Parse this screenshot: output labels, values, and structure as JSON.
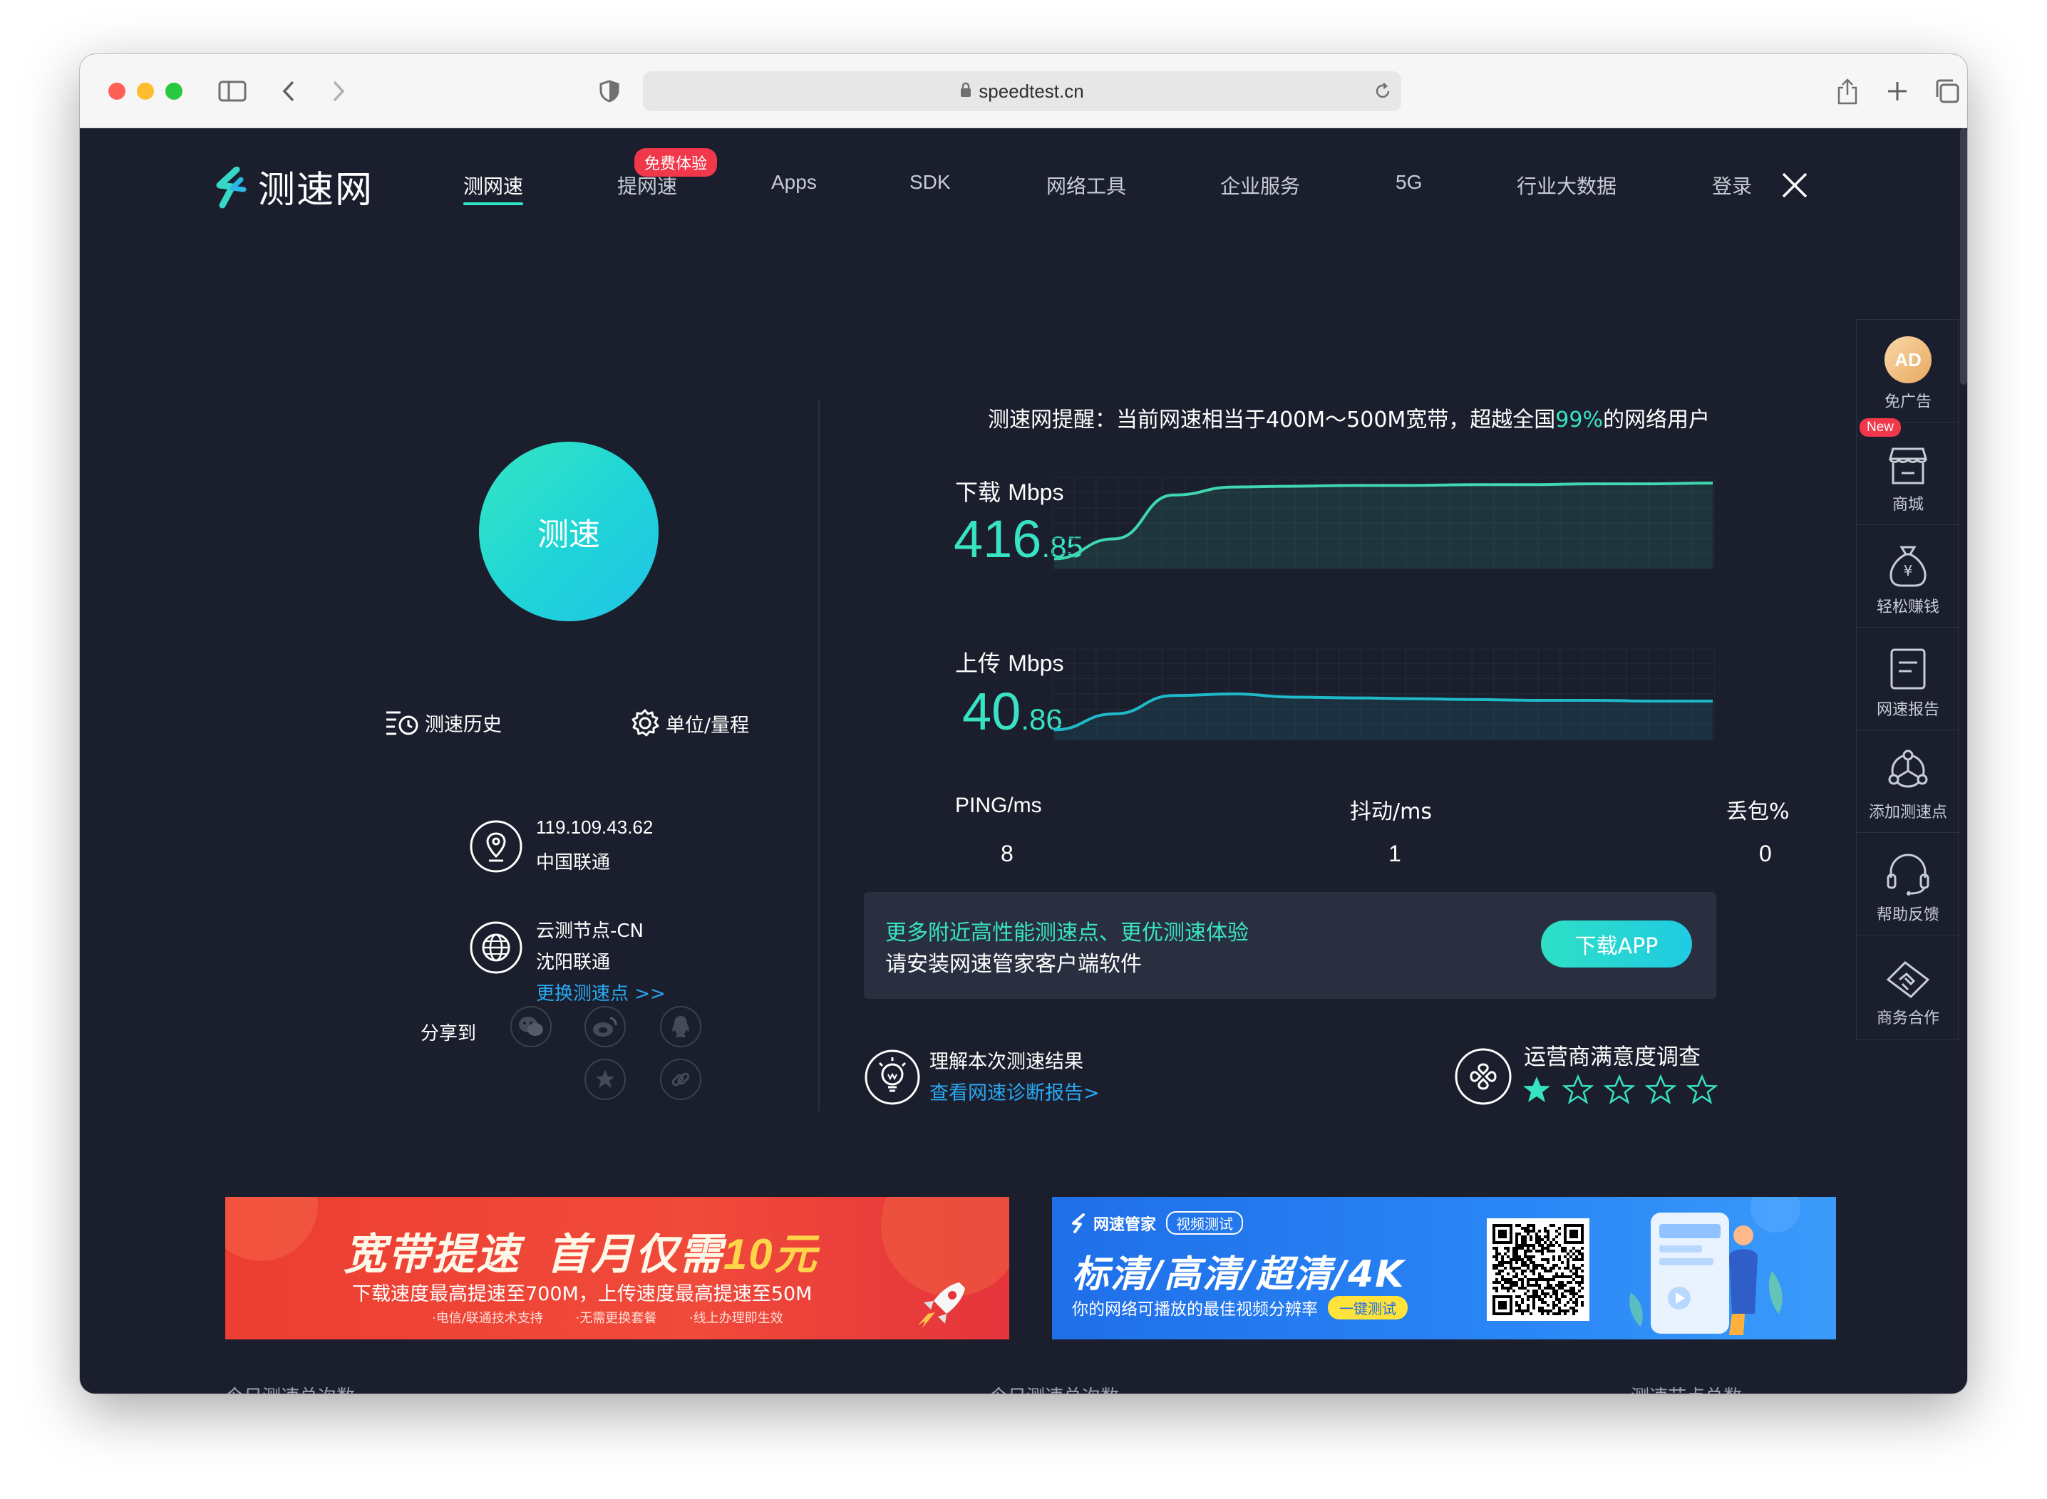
{
  "browser": {
    "url": "speedtest.cn"
  },
  "nav": {
    "logo": "测速网",
    "items": [
      "测网速",
      "提网速",
      "Apps",
      "SDK",
      "网络工具",
      "企业服务",
      "5G",
      "行业大数据"
    ],
    "active": "测网速",
    "badge": "免费体验",
    "login": "登录"
  },
  "left": {
    "test_button": "测速",
    "history": "测速历史",
    "units": "单位/量程",
    "ip": "119.109.43.62",
    "isp": "中国联通",
    "node_name": "云测节点-CN",
    "node_isp": "沈阳联通",
    "change_node": "更换测速点 >>",
    "share_label": "分享到"
  },
  "reminder": {
    "prefix": "测速网提醒：当前网速相当于400M～500M宽带，超越全国",
    "percent": "99%",
    "suffix": "的网络用户"
  },
  "download": {
    "label": "下载",
    "unit": "Mbps",
    "int": "416",
    "dec": ".85"
  },
  "upload": {
    "label": "上传",
    "unit": "Mbps",
    "int": "40",
    "dec": ".86"
  },
  "chart_data": [
    {
      "type": "line",
      "series": [
        {
          "name": "下载",
          "values": [
            5,
            30,
            85,
            95,
            96,
            97,
            97,
            98,
            98,
            99,
            99,
            100
          ]
        }
      ],
      "color": "#3fd6b0"
    },
    {
      "type": "line",
      "series": [
        {
          "name": "上传",
          "values": [
            5,
            25,
            48,
            50,
            46,
            45,
            44,
            43,
            42,
            42,
            41,
            41
          ]
        }
      ],
      "color": "#1fb9c9"
    }
  ],
  "stats": {
    "ping_label": "PING/ms",
    "ping": "8",
    "jitter_label": "抖动/ms",
    "jitter": "1",
    "loss_label": "丢包%",
    "loss": "0"
  },
  "promo": {
    "line1": "更多附近高性能测速点、更优测速体验",
    "line2": "请安装网速管家客户端软件",
    "button": "下载APP"
  },
  "understand": {
    "title": "理解本次测速结果",
    "link": "查看网速诊断报告>"
  },
  "survey": {
    "title": "运营商满意度调查",
    "rating": 1,
    "max": 5
  },
  "sidebar": {
    "items": [
      "免广告",
      "商城",
      "轻松赚钱",
      "网速报告",
      "添加测速点",
      "帮助反馈",
      "商务合作"
    ],
    "new_badge": "New",
    "ad_icon_text": "AD"
  },
  "banner_red": {
    "headline_a": "宽带提速",
    "headline_b": "首月仅需",
    "headline_c": "10元",
    "sub": "下载速度最高提速至700M，上传速度最高提速至50M",
    "foot1": "·电信/联通技术支持",
    "foot2": "·无需更换套餐",
    "foot3": "·线上办理即生效"
  },
  "banner_blue": {
    "brand": "网速管家",
    "tag": "视频测试",
    "headline": "标清/高清/超清/4K",
    "sub": "你的网络可播放的最佳视频分辨率",
    "button": "一键测试"
  },
  "bottom": {
    "a": "今日测速总次数",
    "b": "今日测速总次数",
    "c": "测速节点总数"
  },
  "colors": {
    "accent": "#38e3c4",
    "link": "#2aa8f2",
    "bg": "#1b1f2d"
  }
}
